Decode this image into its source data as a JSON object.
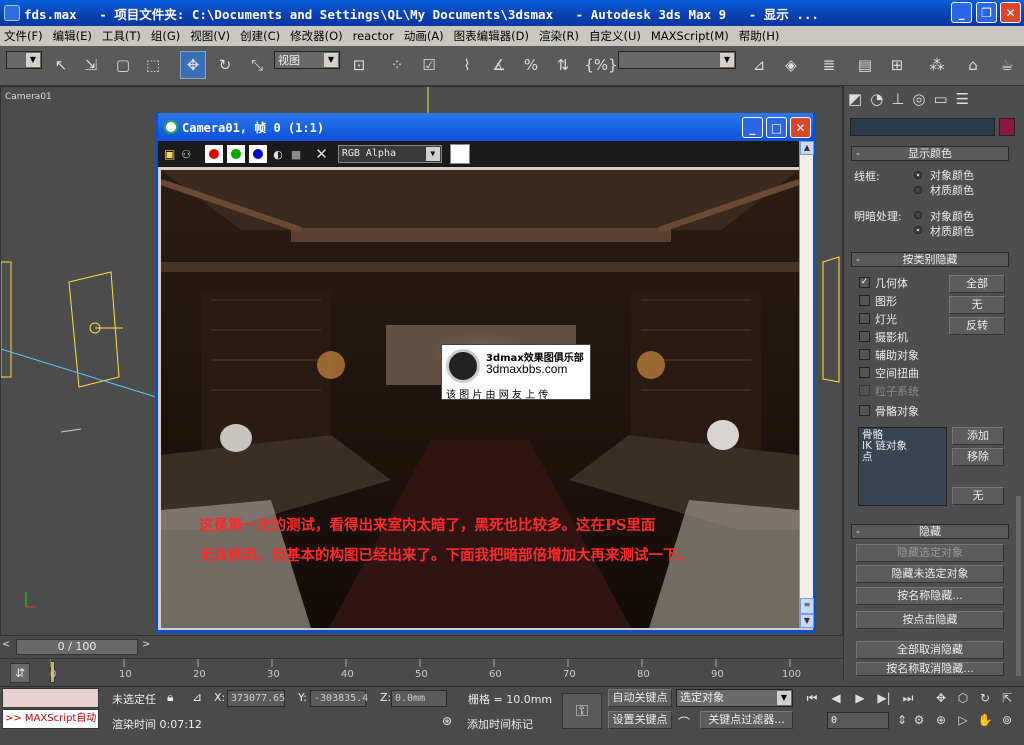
{
  "titlebar": {
    "title": "fds.max   - 项目文件夹: C:\\Documents and Settings\\QL\\My Documents\\3dsmax   - Autodesk 3ds Max 9   - 显示 ...",
    "minimize": "_",
    "restore": "❐",
    "close": "✕"
  },
  "menu": [
    "文件(F)",
    "编辑(E)",
    "工具(T)",
    "组(G)",
    "视图(V)",
    "创建(C)",
    "修改器(O)",
    "reactor",
    "动画(A)",
    "图表编辑器(D)",
    "渲染(R)",
    "自定义(U)",
    "MAXScript(M)",
    "帮助(H)"
  ],
  "toolbar": {
    "view_select": "视图",
    "braces": "{%}"
  },
  "viewport": {
    "label": "Camera01"
  },
  "camera_window": {
    "title": "Camera01, 帧 0 (1:1)",
    "channel": "RGB Alpha"
  },
  "watermark": {
    "brand": "3dmax效果图俱乐部",
    "site": "3dmaxbbs.com",
    "note": "该 图 片 由 网 友 上 传"
  },
  "annotation": {
    "line1": "这是第一次的测试，看得出来室内太暗了，黑死也比较多。这在PS里面",
    "line2": "无法修改。但基本的构图已经出来了。下面我把暗部倍增加大再来测试一下。"
  },
  "command_panel": {
    "display_color": {
      "header": "显示颜色",
      "wireframe_label": "线框:",
      "shaded_label": "明暗处理:",
      "opt_object": "对象颜色",
      "opt_material": "材质颜色"
    },
    "hide_by_category": {
      "header": "按类别隐藏",
      "items": [
        "几何体",
        "图形",
        "灯光",
        "摄影机",
        "辅助对象",
        "空间扭曲",
        "粒子系统",
        "骨骼对象"
      ],
      "btn_all": "全部",
      "btn_none": "无",
      "btn_invert": "反转",
      "list_items": [
        "骨骼",
        "IK 链对象",
        "点"
      ],
      "btn_add": "添加",
      "btn_remove": "移除",
      "btn_none2": "无"
    },
    "hide": {
      "header": "隐藏",
      "buttons": [
        "隐藏选定对象",
        "隐藏未选定对象",
        "按名称隐藏...",
        "按点击隐藏",
        "全部取消隐藏",
        "按名称取消隐藏..."
      ]
    }
  },
  "timeline": {
    "slider": "0 / 100",
    "ticks": [
      "0",
      "10",
      "20",
      "30",
      "40",
      "50",
      "60",
      "70",
      "80",
      "90",
      "100"
    ]
  },
  "status": {
    "maxscript": ">> MAXScript自动",
    "selection": "未选定任",
    "x_label": "X:",
    "x_value": "373077.65",
    "y_label": "Y:",
    "y_value": "-303835.4",
    "z_label": "Z:",
    "z_value": "0.0mm",
    "grid": "栅格 = 10.0mm",
    "render_time": "渲染时间  0:07:12",
    "add_time_tag": "添加时间标记",
    "auto_key": "自动关键点",
    "set_key": "设置关键点",
    "selected_objects": "选定对象",
    "key_filters": "关键点过滤器...",
    "frame": "0"
  }
}
